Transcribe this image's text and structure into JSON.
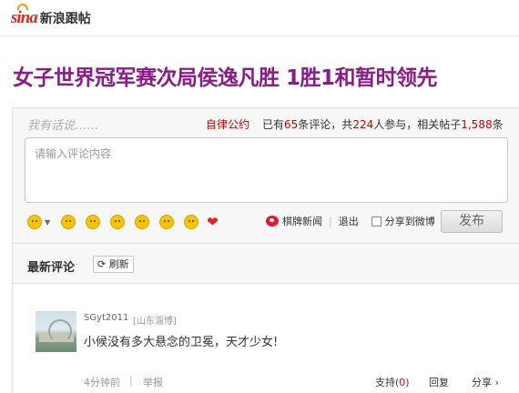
{
  "header": {
    "logo_mark": "sina",
    "logo_text": "新浪跟帖"
  },
  "article": {
    "title": "女子世界冠军赛次局侯逸凡胜 1胜1和暂时领先"
  },
  "comment_panel": {
    "hand_label": "我有话说……",
    "rules_link": "自律公约",
    "stats": {
      "prefix": "已有",
      "comments": "65",
      "mid1": "条评论，共",
      "participants": "224",
      "mid2": "人参与，相关帖子",
      "posts": "1,588",
      "suffix": "条"
    },
    "input_placeholder": "请输入评论内容",
    "chess_news": "棋牌新闻",
    "logout": "退出",
    "share_weibo": "分享到微博",
    "post_button": "发布"
  },
  "latest": {
    "title": "最新评论",
    "refresh_label": "刷新",
    "comments": [
      {
        "user": "SGyt2011",
        "location": "[山东淄博]",
        "text": "小候没有多大悬念的卫冕，天才少女!",
        "time": "4分钟前",
        "report": "举报",
        "support_label": "支持",
        "support_count": "(0)",
        "reply": "回复",
        "share": "分享 ›"
      }
    ]
  },
  "colors": {
    "title": "#8b1a8b",
    "accent_red": "#cc0000"
  }
}
